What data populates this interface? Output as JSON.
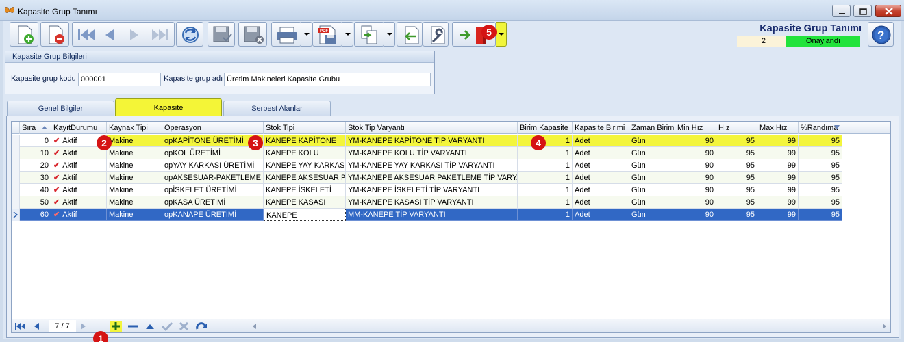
{
  "window": {
    "title": "Kapasite Grup Tanımı"
  },
  "header": {
    "title": "Kapasite Grup Tanımı",
    "number": "2",
    "status": "Onaylandı",
    "status_color": "#22e33c"
  },
  "group": {
    "title": "Kapasite Grup Bilgileri",
    "code_label": "Kapasite grup kodu",
    "code_value": "000001",
    "name_label": "Kapasite grup adı",
    "name_value": "Üretim Makineleri Kapasite Grubu"
  },
  "tabs": [
    {
      "label": "Genel Bilgiler"
    },
    {
      "label": "Kapasite"
    },
    {
      "label": "Serbest Alanlar"
    }
  ],
  "grid": {
    "columns": [
      "Sıra",
      "KayıtDurumu",
      "Kaynak Tipi",
      "Operasyon",
      "Stok Tipi",
      "Stok Tip Varyantı",
      "Birim Kapasite",
      "Kapasite Birimi",
      "Zaman Birimi",
      "Min Hız",
      "Hız",
      "Max Hız",
      "%Randıma"
    ],
    "rows": [
      [
        "0",
        "Aktif",
        "Makine",
        "opKAPİTONE ÜRETİMİ",
        "KANEPE KAPİTONE",
        "YM-KANEPE KAPİTONE TİP VARYANTI",
        "1",
        "Adet",
        "Gün",
        "90",
        "95",
        "99",
        "95"
      ],
      [
        "10",
        "Aktif",
        "Makine",
        "opKOL ÜRETİMİ",
        "KANEPE KOLU",
        "YM-KANEPE KOLU TİP VARYANTI",
        "1",
        "Adet",
        "Gün",
        "90",
        "95",
        "99",
        "95"
      ],
      [
        "20",
        "Aktif",
        "Makine",
        "opYAY KARKASI ÜRETİMİ",
        "KANEPE YAY KARKASI",
        "YM-KANEPE YAY KARKASI TİP VARYANTI",
        "1",
        "Adet",
        "Gün",
        "90",
        "95",
        "99",
        "95"
      ],
      [
        "30",
        "Aktif",
        "Makine",
        "opAKSESUAR-PAKETLEME",
        "KANEPE AKSESUAR PAK",
        "YM-KANEPE AKSESUAR PAKETLEME TİP VARYANTI",
        "1",
        "Adet",
        "Gün",
        "90",
        "95",
        "99",
        "95"
      ],
      [
        "40",
        "Aktif",
        "Makine",
        "opİSKELET ÜRETİMİ",
        "KANEPE İSKELETİ",
        "YM-KANEPE İSKELETİ TİP VARYANTI",
        "1",
        "Adet",
        "Gün",
        "90",
        "95",
        "99",
        "95"
      ],
      [
        "50",
        "Aktif",
        "Makine",
        "opKASA ÜRETİMİ",
        "KANEPE KASASI",
        "YM-KANEPE KASASI TİP VARYANTI",
        "1",
        "Adet",
        "Gün",
        "90",
        "95",
        "99",
        "95"
      ],
      [
        "60",
        "Aktif",
        "Makine",
        "opKANAPE ÜRETİMİ",
        "KANEPE",
        "MM-KANEPE TİP VARYANTI",
        "1",
        "Adet",
        "Gün",
        "90",
        "95",
        "99",
        "95"
      ]
    ]
  },
  "navigator": {
    "count": "7 / 7"
  },
  "badges": [
    "1",
    "2",
    "3",
    "4",
    "5"
  ],
  "colors": {
    "highlight": "#f3f53c",
    "selection": "#3168c5",
    "badge": "#d51414"
  }
}
